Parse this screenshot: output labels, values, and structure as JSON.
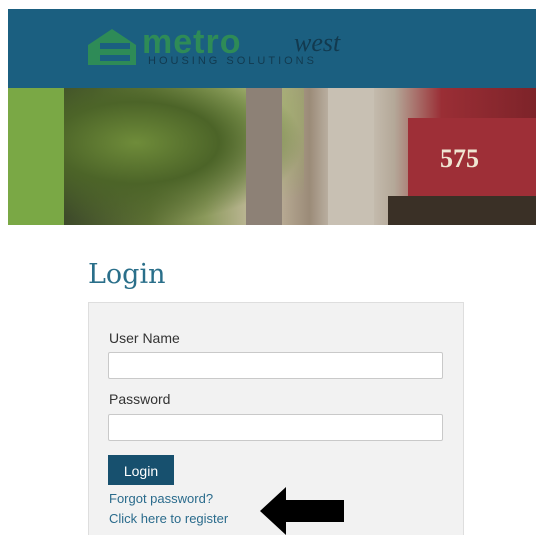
{
  "brand": {
    "name_bold": "metro",
    "name_script": "west",
    "tagline": "HOUSING SOLUTIONS",
    "colors": {
      "header": "#1b5f80",
      "logo_green": "#2e8b57",
      "logo_dark": "#123a4f"
    }
  },
  "banner": {
    "building_number": "575",
    "icon": "banner-photo"
  },
  "login": {
    "title": "Login",
    "username_label": "User Name",
    "username_value": "",
    "password_label": "Password",
    "password_value": "",
    "submit_label": "Login",
    "forgot_link": "Forgot password?",
    "register_link": "Click here to register",
    "colors": {
      "title": "#2a6f8a",
      "button": "#17506e",
      "link": "#2a6b8c"
    }
  },
  "annotation": {
    "icon": "arrow-left-icon"
  }
}
